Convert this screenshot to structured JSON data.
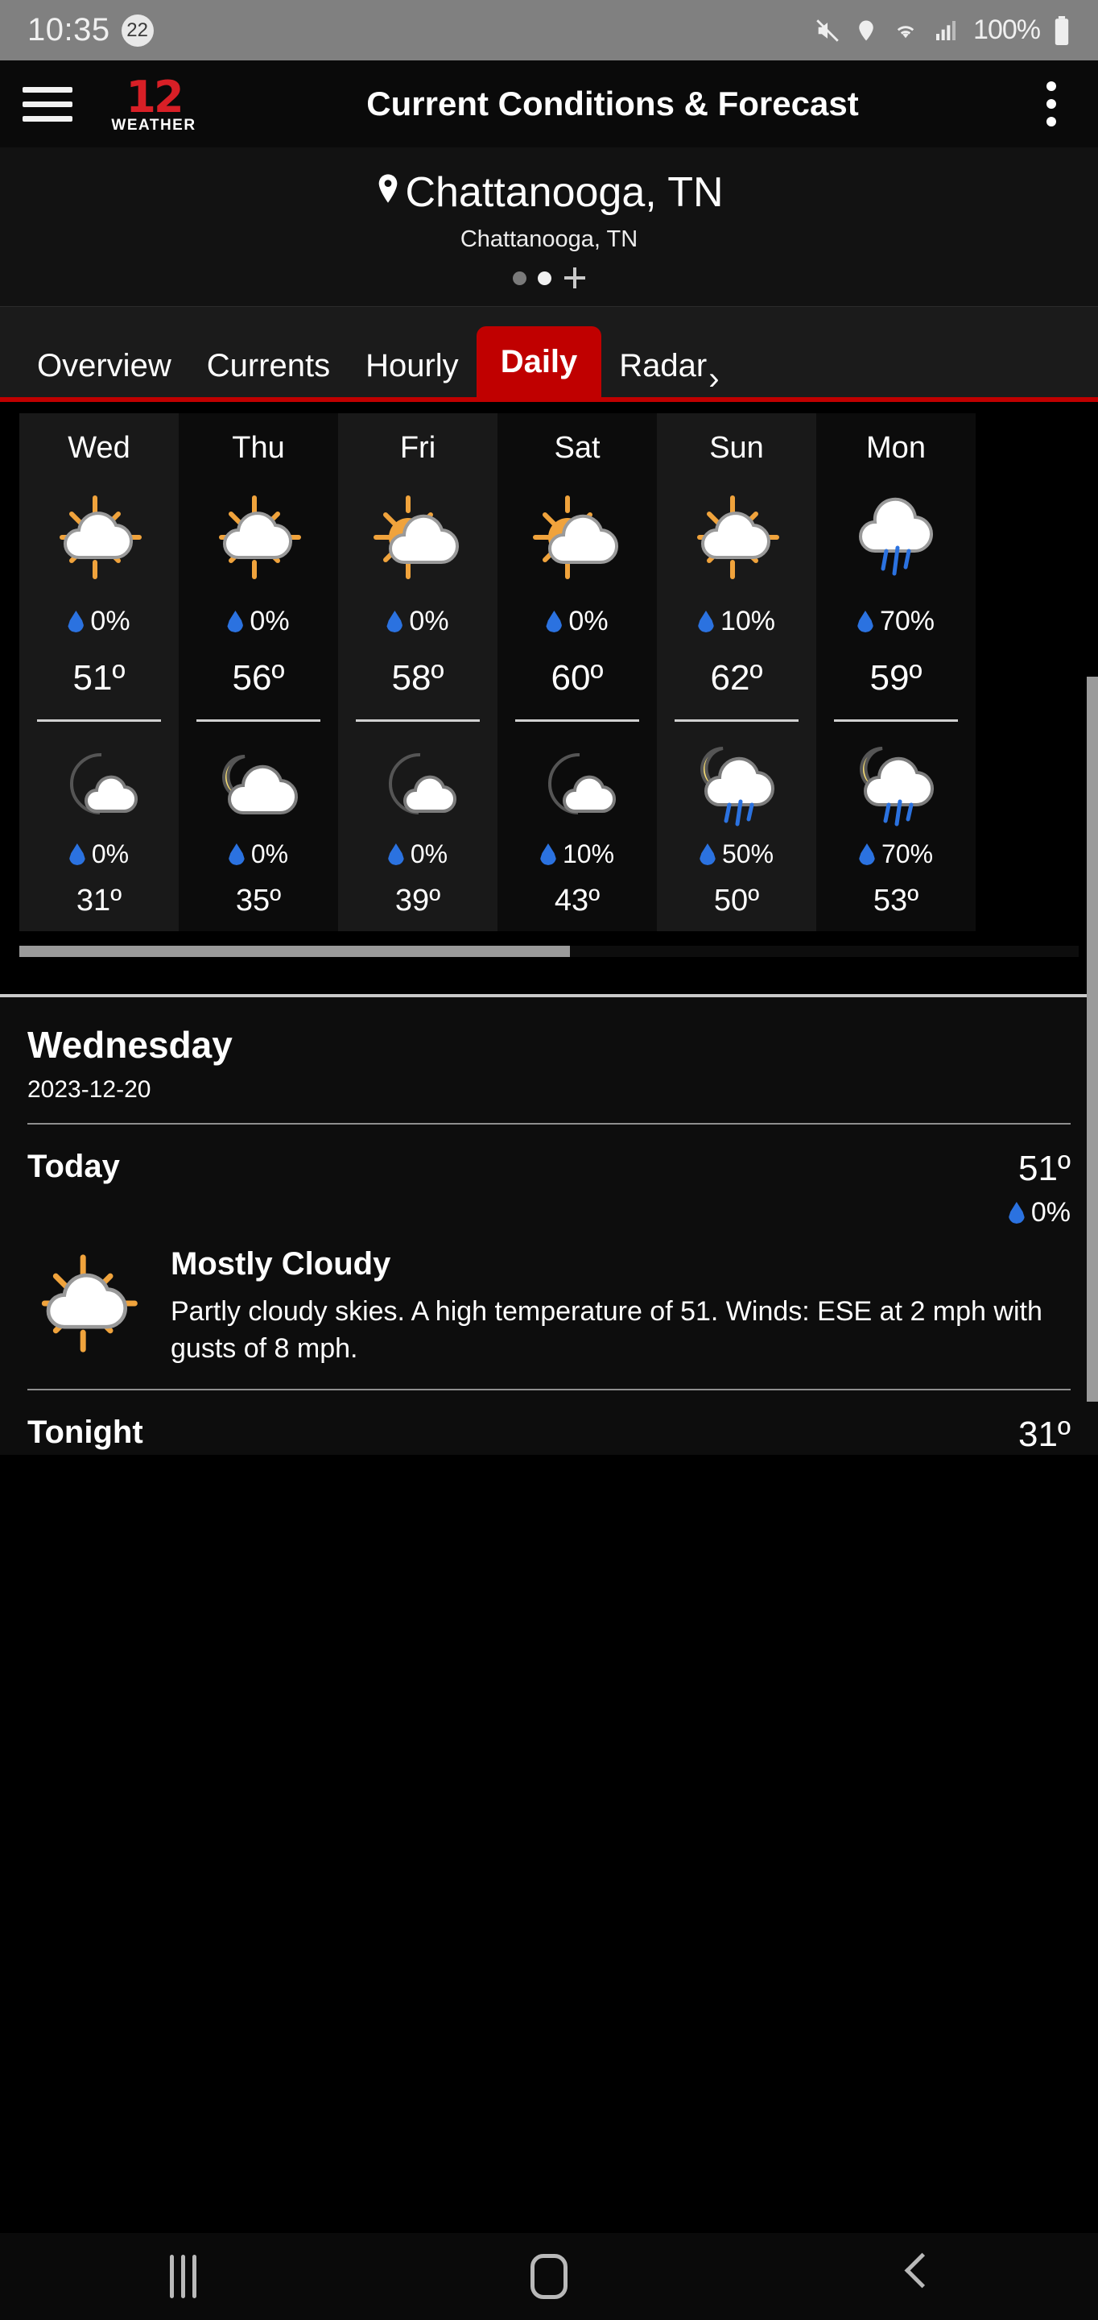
{
  "status_bar": {
    "time": "10:35",
    "notification_count": "22",
    "battery_percent": "100%",
    "icons": [
      "mute-icon",
      "location-icon",
      "wifi-icon",
      "signal-icon",
      "battery-icon"
    ]
  },
  "app_bar": {
    "menu_icon": "hamburger-menu-icon",
    "logo_channel": "12",
    "logo_word": "WEATHER",
    "title": "Current Conditions & Forecast",
    "overflow_icon": "kebab-menu-icon"
  },
  "location": {
    "pin_icon": "location-pin-icon",
    "name": "Chattanooga, TN",
    "subtitle": "Chattanooga, TN",
    "page_dots": [
      false,
      true
    ],
    "add_label": "+"
  },
  "tabs": {
    "items": [
      {
        "label": "Overview",
        "active": false
      },
      {
        "label": "Currents",
        "active": false
      },
      {
        "label": "Hourly",
        "active": false
      },
      {
        "label": "Daily",
        "active": true
      },
      {
        "label": "Radar",
        "active": false
      }
    ],
    "active_color": "#c00000",
    "more_chevron": "›"
  },
  "daily_forecast": [
    {
      "day": "Wed",
      "day_icon": "sun-behind-cloud-icon",
      "day_pop": "0%",
      "high": "51º",
      "night_icon": "moon-with-cloud-icon",
      "night_pop": "0%",
      "low": "31º"
    },
    {
      "day": "Thu",
      "day_icon": "sun-behind-cloud-icon",
      "day_pop": "0%",
      "high": "56º",
      "night_icon": "mostly-cloudy-night-icon",
      "night_pop": "0%",
      "low": "35º"
    },
    {
      "day": "Fri",
      "day_icon": "partly-sunny-icon",
      "day_pop": "0%",
      "high": "58º",
      "night_icon": "moon-with-cloud-icon",
      "night_pop": "0%",
      "low": "39º"
    },
    {
      "day": "Sat",
      "day_icon": "partly-sunny-icon",
      "day_pop": "0%",
      "high": "60º",
      "night_icon": "moon-with-cloud-icon",
      "night_pop": "10%",
      "low": "43º"
    },
    {
      "day": "Sun",
      "day_icon": "sun-behind-cloud-icon",
      "day_pop": "10%",
      "high": "62º",
      "night_icon": "moon-cloud-rain-icon",
      "night_pop": "50%",
      "low": "50º"
    },
    {
      "day": "Mon",
      "day_icon": "cloud-rain-icon",
      "day_pop": "70%",
      "high": "59º",
      "night_icon": "moon-cloud-rain-icon",
      "night_pop": "70%",
      "low": "53º"
    }
  ],
  "detail": {
    "day_name": "Wednesday",
    "date": "2023-12-20",
    "today": {
      "label": "Today",
      "temp": "51º",
      "pop": "0%",
      "icon": "sun-behind-cloud-icon",
      "condition": "Mostly Cloudy",
      "description": "Partly cloudy skies. A high temperature of 51. Winds: ESE at 2 mph with gusts of 8 mph."
    },
    "tonight": {
      "label": "Tonight",
      "temp": "31º"
    }
  },
  "nav_bar": {
    "recents_icon": "recents-icon",
    "home_icon": "home-icon",
    "back_icon": "back-icon"
  },
  "colors": {
    "brand_red": "#d81f26",
    "tab_red": "#c00000",
    "rain_blue": "#2b72e0",
    "sun_orange": "#f0a33c",
    "moon_yellow": "#f7dd72"
  }
}
